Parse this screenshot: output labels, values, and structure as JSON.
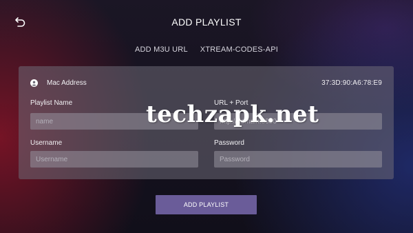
{
  "header": {
    "title": "ADD PLAYLIST",
    "back_icon": "back-arrow-icon"
  },
  "tabs": [
    {
      "label": "ADD M3U URL"
    },
    {
      "label": "XTREAM-CODES-API"
    }
  ],
  "form": {
    "mac_icon": "account-circle-icon",
    "mac_label": "Mac Address",
    "mac_value": "37:3D:90:A6:78:E9",
    "playlist_name": {
      "label": "Playlist Name",
      "placeholder": "name",
      "value": ""
    },
    "url_port": {
      "label": "URL + Port",
      "placeholder": "http://domain:8080",
      "value": ""
    },
    "username": {
      "label": "Username",
      "placeholder": "Username",
      "value": ""
    },
    "password": {
      "label": "Password",
      "placeholder": "Password",
      "value": ""
    }
  },
  "submit_label": "ADD PLAYLIST",
  "watermark": "techzapk.net",
  "colors": {
    "accent_button": "#6a5c99",
    "card": "#6e6a76",
    "background": "#15121f"
  }
}
